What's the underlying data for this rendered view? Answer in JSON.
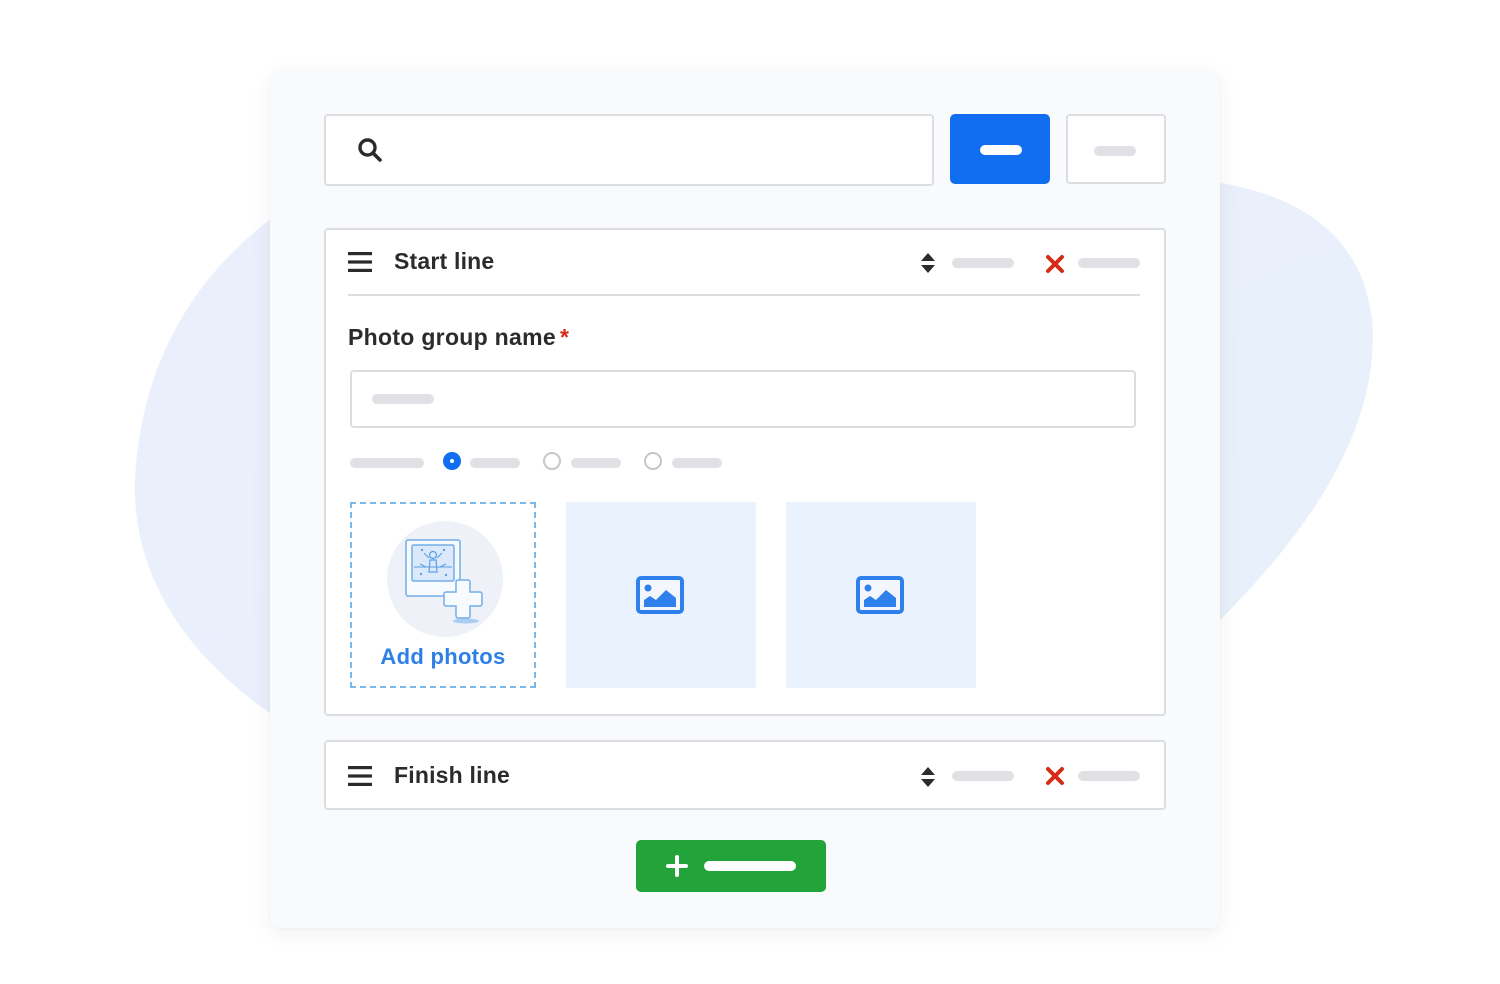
{
  "colors": {
    "primary": "#126ef0",
    "success": "#22a43a",
    "danger": "#d42b17",
    "link": "#2e7fe6",
    "tile_bg": "#e9f2fd",
    "placeholder_pill": "#dfe1e4",
    "blob": "#e9f0fb"
  },
  "toolbar": {
    "search": {
      "icon": "search-icon",
      "value": "",
      "placeholder": ""
    },
    "primary_button": {
      "label_placeholder": true
    },
    "secondary_button": {
      "label_placeholder": true
    }
  },
  "sections": [
    {
      "title": "Start line",
      "expanded": true,
      "drag_icon": "menu-icon",
      "sort_icon": "sort-icon",
      "delete_icon": "close-icon",
      "field": {
        "label": "Photo group name",
        "required_mark": "*",
        "value": ""
      },
      "radio_group": {
        "options_count": 3,
        "selected_index": 0
      },
      "photos": {
        "add_label": "Add photos",
        "items": [
          {
            "icon": "image-icon"
          },
          {
            "icon": "image-icon"
          }
        ]
      }
    },
    {
      "title": "Finish line",
      "expanded": false,
      "drag_icon": "menu-icon",
      "sort_icon": "sort-icon",
      "delete_icon": "close-icon"
    }
  ],
  "add_section_button": {
    "icon": "plus-icon",
    "label_placeholder": true
  }
}
